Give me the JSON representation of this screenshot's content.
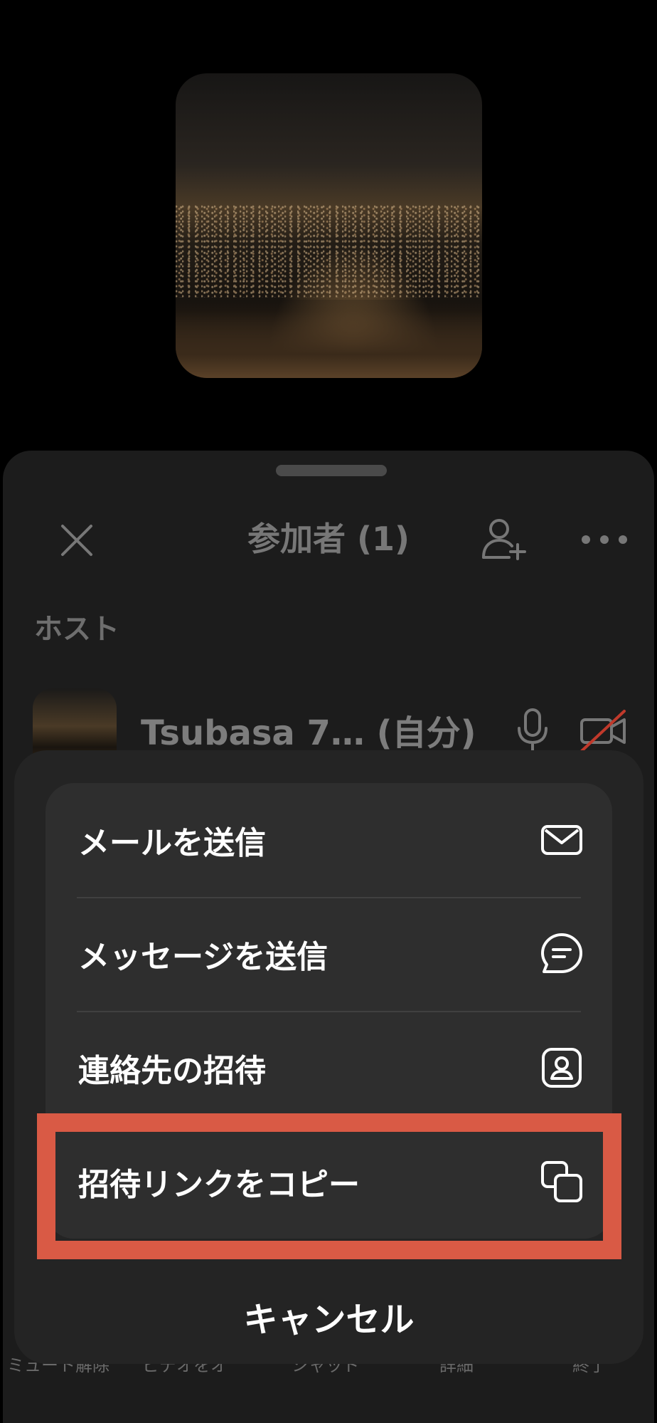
{
  "participants_panel": {
    "title": "参加者 (1)",
    "section_host": "ホスト",
    "participant": {
      "name": "Tsubasa 7… (自分)",
      "mic_state": "on",
      "video_state": "off"
    },
    "icons": {
      "close": "close-icon",
      "invite": "add-person-icon",
      "more": "more-icon",
      "mic": "microphone-icon",
      "video_off": "video-off-icon"
    }
  },
  "toolbar": {
    "items": [
      "ミュート解除",
      "ビデオをオ",
      "シャッド",
      "詳細",
      "終了"
    ]
  },
  "action_sheet": {
    "items": [
      {
        "label": "メールを送信",
        "icon": "mail-icon"
      },
      {
        "label": "メッセージを送信",
        "icon": "chat-icon"
      },
      {
        "label": "連絡先の招待",
        "icon": "contact-icon"
      },
      {
        "label": "招待リンクをコピー",
        "icon": "copy-icon",
        "highlighted": true
      }
    ],
    "cancel_label": "キャンセル"
  },
  "colors": {
    "highlight": "#d95a45",
    "sheet_bg": "#242424",
    "group_bg": "#2e2e2e"
  }
}
